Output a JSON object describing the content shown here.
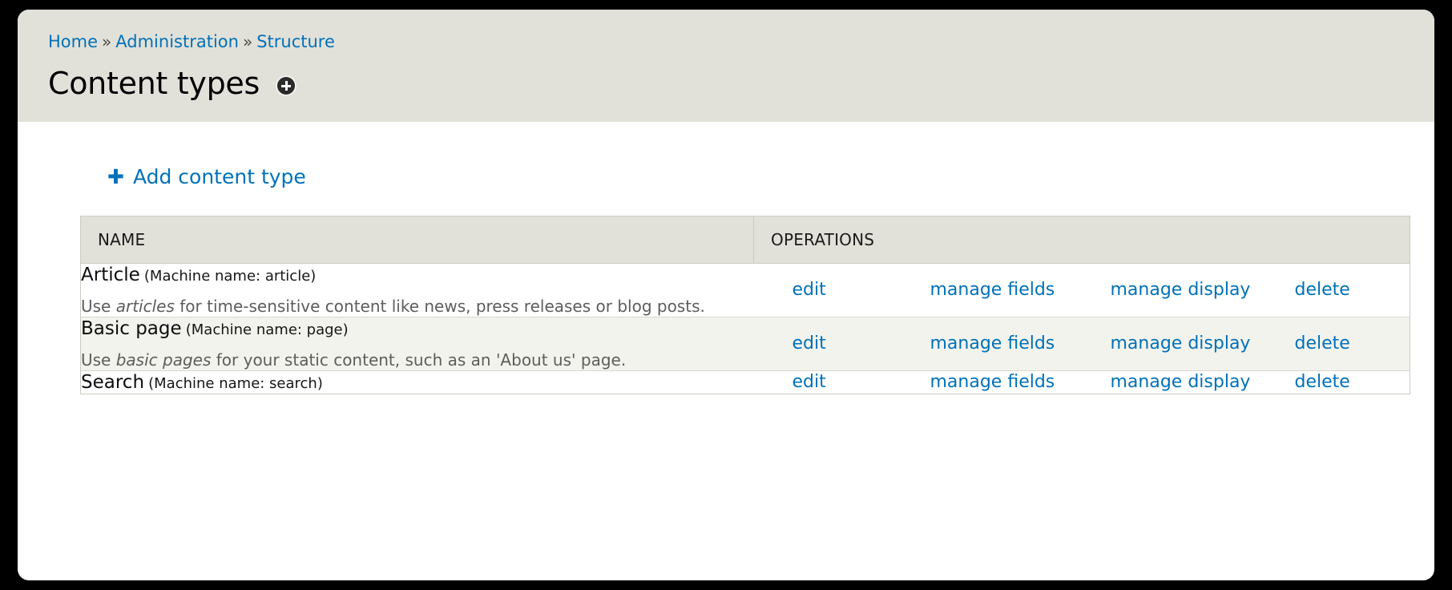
{
  "breadcrumb": {
    "separator": "»",
    "items": [
      {
        "label": "Home"
      },
      {
        "label": "Administration"
      },
      {
        "label": "Structure"
      }
    ]
  },
  "header": {
    "title": "Content types",
    "contextual_icon": "circle-plus-icon"
  },
  "action_links": {
    "add_content_type": {
      "label": "Add content type",
      "icon": "plus-icon",
      "glyph": "✚"
    }
  },
  "table": {
    "columns": [
      {
        "key": "name",
        "label": "Name"
      },
      {
        "key": "operations",
        "label": "Operations"
      }
    ],
    "rows": [
      {
        "name": "Article",
        "machine_name_label": "(Machine name: article)",
        "description_before": "Use ",
        "description_em": "articles",
        "description_after": " for time-sensitive content like news, press releases or blog posts.",
        "operations": [
          {
            "label": "edit"
          },
          {
            "label": "manage fields"
          },
          {
            "label": "manage display"
          },
          {
            "label": "delete"
          }
        ]
      },
      {
        "name": "Basic page",
        "machine_name_label": "(Machine name: page)",
        "description_before": "Use ",
        "description_em": "basic pages",
        "description_after": " for your static content, such as an 'About us' page.",
        "operations": [
          {
            "label": "edit"
          },
          {
            "label": "manage fields"
          },
          {
            "label": "manage display"
          },
          {
            "label": "delete"
          }
        ]
      },
      {
        "name": "Search",
        "machine_name_label": "(Machine name: search)",
        "description_before": "",
        "description_em": "",
        "description_after": "",
        "operations": [
          {
            "label": "edit"
          },
          {
            "label": "manage fields"
          },
          {
            "label": "manage display"
          },
          {
            "label": "delete"
          }
        ]
      }
    ]
  },
  "colors": {
    "link": "#0071b8",
    "header_band": "#e2e1d9",
    "row_stripe": "#f3f3ed",
    "page_background": "#000000"
  }
}
